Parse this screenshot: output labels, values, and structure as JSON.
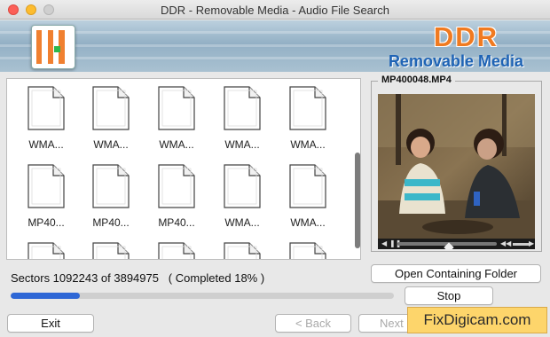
{
  "window": {
    "title": "DDR - Removable Media - Audio File Search"
  },
  "banner": {
    "brand": "DDR",
    "product": "Removable Media",
    "logo_icon": "checker-logo-icon"
  },
  "files": [
    {
      "label": "WMA..."
    },
    {
      "label": "WMA..."
    },
    {
      "label": "WMA..."
    },
    {
      "label": "WMA..."
    },
    {
      "label": "WMA..."
    },
    {
      "label": "MP40..."
    },
    {
      "label": "MP40..."
    },
    {
      "label": "MP40..."
    },
    {
      "label": "WMA..."
    },
    {
      "label": "WMA..."
    },
    {
      "label": ""
    },
    {
      "label": ""
    },
    {
      "label": ""
    },
    {
      "label": ""
    },
    {
      "label": ""
    }
  ],
  "preview": {
    "title": "MP400048.MP4",
    "playback_progress": 0.33
  },
  "status": {
    "text": "Sectors 1092243 of 3894975   ( Completed 18% )",
    "percent": 18
  },
  "buttons": {
    "open_folder": "Open Containing Folder",
    "stop": "Stop",
    "exit": "Exit",
    "back": "< Back",
    "next": "Next >"
  },
  "watermark": "FixDigicam.com",
  "colors": {
    "brand_orange": "#f07a20",
    "brand_blue": "#1e63b5",
    "progress_blue": "#2e67d6"
  }
}
